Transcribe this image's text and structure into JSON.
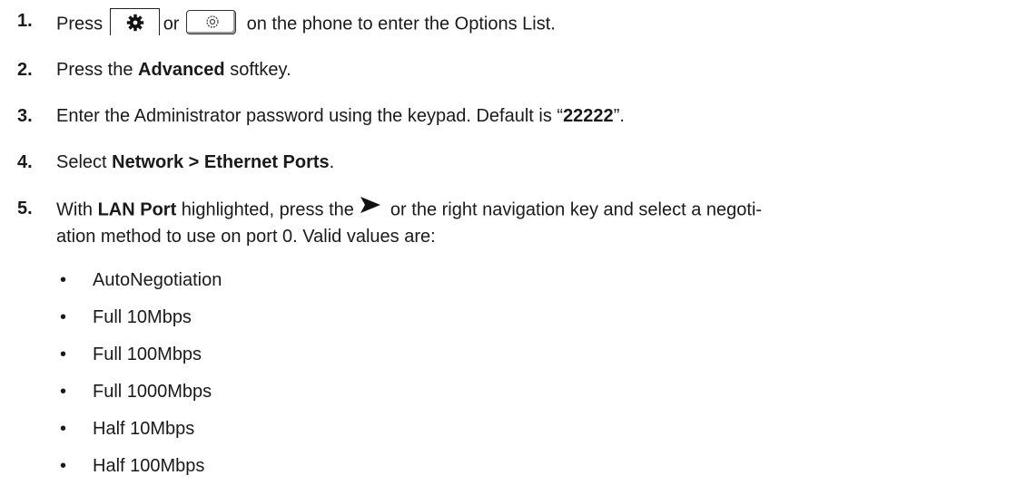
{
  "steps": [
    {
      "number": "1.",
      "pre": "Press",
      "or": "or",
      "post": "on the phone to enter the Options List."
    },
    {
      "number": "2.",
      "pre": "Press the ",
      "bold": "Advanced",
      "post": " softkey."
    },
    {
      "number": "3.",
      "pre": "Enter the Administrator password using the keypad. Default is “",
      "bold": "22222",
      "post": "”."
    },
    {
      "number": "4.",
      "pre": "Select ",
      "bold": "Network > Ethernet Ports",
      "post": "."
    },
    {
      "number": "5.",
      "pre": "With ",
      "bold": "LAN Port",
      "mid": " highlighted, press the",
      "post": "or the right navigation key and select a negoti-",
      "line2": "ation method to use on port 0. Valid values are:"
    }
  ],
  "values": [
    "AutoNegotiation",
    "Full 10Mbps",
    "Full 100Mbps",
    "Full 1000Mbps",
    "Half 10Mbps",
    "Half 100Mbps"
  ],
  "bullet_char": "•",
  "icons": [
    "gear-icon",
    "options-key-icon",
    "right-arrow-icon"
  ]
}
